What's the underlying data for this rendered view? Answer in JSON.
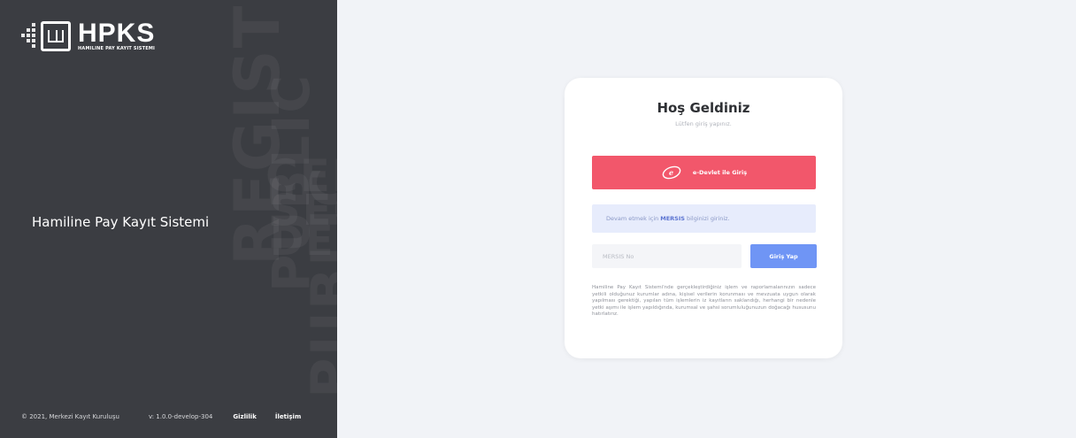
{
  "sidebar": {
    "logo_title": "HPKS",
    "logo_subtitle": "HAMILINE PAY KAYIT SISTEMI",
    "system_name": "Hamiline Pay Kayıt Sistemi",
    "background_words": [
      "REGISTRY",
      "PUBLIC",
      "PUBLIC",
      "CEN",
      "SEC",
      "DEP"
    ],
    "footer": {
      "copyright": "© 2021, Merkezi Kayıt Kuruluşu",
      "version": "v: 1.0.0-develop-304",
      "privacy_link": "Gizlilik",
      "contact_link": "İletişim"
    }
  },
  "card": {
    "title": "Hoş Geldiniz",
    "subtitle": "Lütfen giriş yapınız.",
    "edevlet_button": "e-Devlet ile Giriş",
    "info": {
      "prefix": "Devam etmek için",
      "highlight": "MERSIS",
      "suffix": "bilginizi giriniz."
    },
    "mersis_input": {
      "placeholder": "MERSIS No",
      "value": ""
    },
    "login_button": "Giriş Yap",
    "legal_text": "Hamiline Pay Kayıt Sistemi'nde gerçekleştirdiğiniz işlem ve raporlamalarınızın sadece yetkili olduğunuz kurumlar adına, kişisel verilerin korunması ve mevzuata uygun olarak yapılması gerektiği, yapılan tüm işlemlerin iz kayıtların saklandığı, herhangi bir nedenle yetki aşımı ile işlem yapıldığında, kurumsal ve şahsi sorumluluğunuzun doğacağı hususunu hatırlatırız."
  },
  "colors": {
    "sidebar_bg": "#3b3d42",
    "page_bg": "#f1f3f7",
    "edevlet_red": "#f2576b",
    "login_blue": "#6f95f5",
    "info_bg": "#e7ecfc",
    "info_highlight": "#5a73d1"
  }
}
